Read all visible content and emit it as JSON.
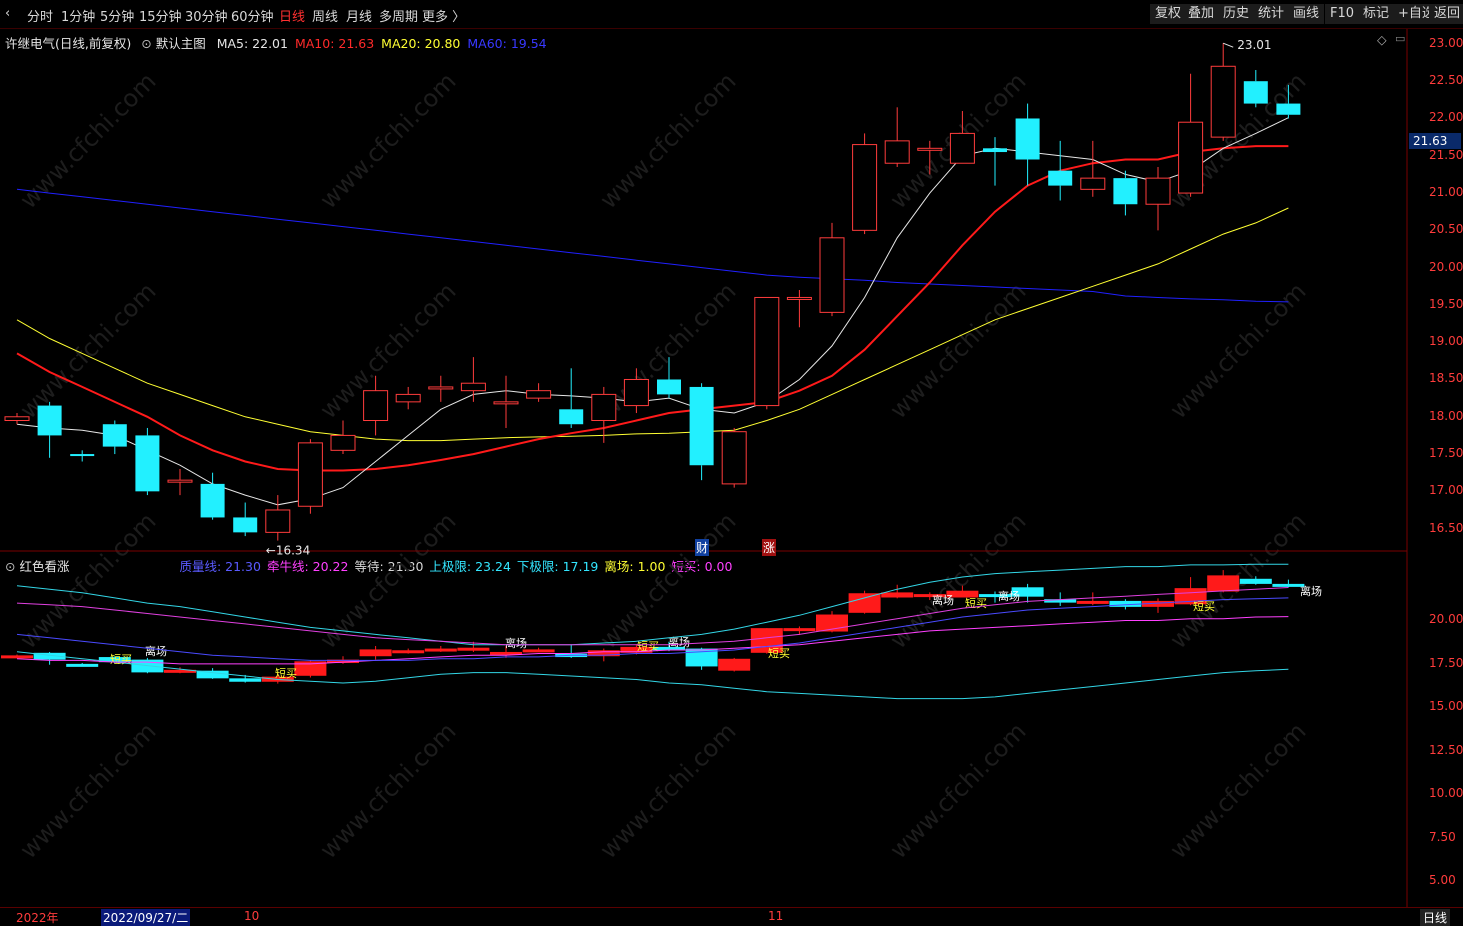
{
  "periods": [
    {
      "label": "分时",
      "active": false
    },
    {
      "label": "1分钟",
      "active": false
    },
    {
      "label": "5分钟",
      "active": false
    },
    {
      "label": "15分钟",
      "active": false
    },
    {
      "label": "30分钟",
      "active": false
    },
    {
      "label": "60分钟",
      "active": false
    },
    {
      "label": "日线",
      "active": true
    },
    {
      "label": "周线",
      "active": false
    },
    {
      "label": "月线",
      "active": false
    },
    {
      "label": "多周期",
      "active": false
    },
    {
      "label": "更多 〉",
      "active": false
    }
  ],
  "toolbar": [
    "复权",
    "叠加",
    "历史",
    "统计",
    "画线",
    "F10",
    "标记",
    "+自选",
    "返回"
  ],
  "legend_main": {
    "stock": "许继电气(日线,前复权)",
    "template": "默认主图",
    "items": [
      {
        "text": "MA5: 22.01",
        "color": "#e6e6e6"
      },
      {
        "text": "MA10: 21.63",
        "color": "#ff2a2a"
      },
      {
        "text": "MA20: 20.80",
        "color": "#ffff33"
      },
      {
        "text": "MA60: 19.54",
        "color": "#3838ff"
      }
    ]
  },
  "legend_sub": {
    "name": "红色看涨",
    "items": [
      {
        "text": "质量线: 21.30",
        "color": "#5a5aff"
      },
      {
        "text": "牵牛线: 20.22",
        "color": "#ff40ff"
      },
      {
        "text": "等待: 21.30",
        "color": "#d8d8d8"
      },
      {
        "text": "上极限: 23.24",
        "color": "#33e6ff"
      },
      {
        "text": "下极限: 17.19",
        "color": "#33e6ff"
      },
      {
        "text": "离场: 1.00",
        "color": "#ffff33"
      },
      {
        "text": "短买: 0.00",
        "color": "#ff40ff"
      }
    ]
  },
  "axis_main": [
    "23.00",
    "22.50",
    "22.00",
    "21.50",
    "21.00",
    "20.50",
    "20.00",
    "19.50",
    "19.00",
    "18.50",
    "18.00",
    "17.50",
    "17.00",
    "16.50"
  ],
  "axis_sub": [
    "20.00",
    "17.50",
    "15.00",
    "12.50",
    "10.00",
    "7.50",
    "5.00"
  ],
  "last_price": "21.63",
  "high_label": "23.01",
  "low_label": "16.34",
  "markers": {
    "cai": "财",
    "zhang": "涨"
  },
  "sub_text": {
    "exit": "离场",
    "buy": "短买"
  },
  "dates": {
    "year": "2022年",
    "cursor": "2022/09/27/二",
    "m10": "10",
    "m11": "11",
    "period": "日线"
  },
  "watermark": "www.cfchi.com",
  "chart_data": {
    "type": "candlestick",
    "ylim": [
      16.2,
      23.2
    ],
    "candles": [
      [
        17.95,
        18.0,
        17.9,
        18.05
      ],
      [
        18.15,
        17.75,
        17.45,
        18.2
      ],
      [
        17.5,
        17.48,
        17.4,
        17.55
      ],
      [
        17.9,
        17.6,
        17.5,
        17.95
      ],
      [
        17.75,
        17.0,
        16.95,
        17.85
      ],
      [
        17.15,
        17.15,
        16.95,
        17.3
      ],
      [
        17.1,
        16.65,
        16.62,
        17.25
      ],
      [
        16.65,
        16.45,
        16.4,
        16.85
      ],
      [
        16.45,
        16.75,
        16.34,
        16.95
      ],
      [
        16.8,
        17.65,
        16.7,
        17.7
      ],
      [
        17.55,
        17.75,
        17.5,
        17.95
      ],
      [
        17.95,
        18.35,
        17.75,
        18.55
      ],
      [
        18.2,
        18.3,
        18.1,
        18.4
      ],
      [
        18.4,
        18.4,
        18.2,
        18.55
      ],
      [
        18.35,
        18.45,
        18.2,
        18.8
      ],
      [
        18.2,
        18.2,
        17.85,
        18.55
      ],
      [
        18.25,
        18.35,
        18.2,
        18.45
      ],
      [
        18.1,
        17.9,
        17.85,
        18.65
      ],
      [
        17.95,
        18.3,
        17.65,
        18.4
      ],
      [
        18.15,
        18.5,
        18.05,
        18.65
      ],
      [
        18.5,
        18.3,
        18.25,
        18.8
      ],
      [
        18.4,
        17.35,
        17.15,
        18.45
      ],
      [
        17.1,
        17.8,
        17.05,
        17.85
      ],
      [
        18.15,
        19.6,
        18.1,
        19.6
      ],
      [
        19.6,
        19.6,
        19.2,
        19.7
      ],
      [
        19.4,
        20.4,
        19.35,
        20.6
      ],
      [
        20.5,
        21.65,
        20.45,
        21.8
      ],
      [
        21.4,
        21.7,
        21.35,
        22.15
      ],
      [
        21.6,
        21.6,
        21.25,
        21.7
      ],
      [
        21.4,
        21.8,
        21.4,
        22.1
      ],
      [
        21.6,
        21.55,
        21.1,
        21.75
      ],
      [
        22.0,
        21.45,
        21.1,
        22.2
      ],
      [
        21.3,
        21.1,
        20.9,
        21.7
      ],
      [
        21.05,
        21.2,
        20.95,
        21.7
      ],
      [
        21.2,
        20.85,
        20.7,
        21.3
      ],
      [
        20.85,
        21.2,
        20.5,
        21.35
      ],
      [
        21.0,
        21.95,
        20.95,
        22.6
      ],
      [
        21.75,
        22.7,
        21.7,
        23.01
      ],
      [
        22.5,
        22.2,
        22.15,
        22.65
      ],
      [
        22.2,
        22.05,
        22.0,
        22.45
      ]
    ],
    "ma5": [
      17.9,
      17.85,
      17.82,
      17.75,
      17.55,
      17.35,
      17.1,
      16.95,
      16.82,
      16.9,
      17.05,
      17.4,
      17.75,
      18.1,
      18.3,
      18.35,
      18.3,
      18.28,
      18.25,
      18.2,
      18.25,
      18.1,
      18.05,
      18.2,
      18.5,
      18.95,
      19.6,
      20.4,
      21.0,
      21.5,
      21.6,
      21.55,
      21.5,
      21.45,
      21.25,
      21.15,
      21.3,
      21.6,
      21.8,
      22.01
    ],
    "ma10": [
      18.85,
      18.6,
      18.4,
      18.2,
      18.0,
      17.75,
      17.55,
      17.4,
      17.3,
      17.28,
      17.28,
      17.3,
      17.35,
      17.42,
      17.5,
      17.6,
      17.7,
      17.78,
      17.85,
      17.95,
      18.05,
      18.1,
      18.15,
      18.2,
      18.35,
      18.55,
      18.9,
      19.35,
      19.8,
      20.3,
      20.75,
      21.1,
      21.3,
      21.4,
      21.45,
      21.45,
      21.55,
      21.6,
      21.63,
      21.63
    ],
    "ma20": [
      19.3,
      19.05,
      18.85,
      18.65,
      18.45,
      18.3,
      18.15,
      18.0,
      17.9,
      17.8,
      17.75,
      17.7,
      17.68,
      17.68,
      17.7,
      17.72,
      17.73,
      17.74,
      17.75,
      17.77,
      17.78,
      17.8,
      17.82,
      17.95,
      18.1,
      18.3,
      18.5,
      18.7,
      18.9,
      19.1,
      19.3,
      19.45,
      19.6,
      19.75,
      19.9,
      20.05,
      20.25,
      20.45,
      20.6,
      20.8
    ],
    "ma60": [
      21.05,
      21.0,
      20.95,
      20.9,
      20.85,
      20.8,
      20.75,
      20.7,
      20.65,
      20.6,
      20.55,
      20.5,
      20.45,
      20.4,
      20.35,
      20.3,
      20.25,
      20.2,
      20.15,
      20.1,
      20.05,
      20.0,
      19.95,
      19.9,
      19.87,
      19.85,
      19.83,
      19.8,
      19.78,
      19.76,
      19.74,
      19.72,
      19.7,
      19.68,
      19.62,
      19.6,
      19.58,
      19.57,
      19.55,
      19.54
    ]
  },
  "chart_data_sub": {
    "type": "line",
    "ylim": [
      3.5,
      24.0
    ],
    "upper": [
      22.0,
      21.8,
      21.6,
      21.3,
      21.0,
      20.8,
      20.5,
      20.2,
      19.9,
      19.6,
      19.4,
      19.2,
      19.0,
      18.8,
      18.6,
      18.6,
      18.6,
      18.6,
      18.7,
      18.8,
      19.0,
      19.2,
      19.5,
      19.9,
      20.3,
      20.8,
      21.3,
      21.8,
      22.2,
      22.5,
      22.7,
      22.8,
      22.9,
      23.0,
      23.1,
      23.1,
      23.2,
      23.2,
      23.24,
      23.24
    ],
    "lower": [
      18.2,
      18.0,
      17.8,
      17.6,
      17.4,
      17.2,
      17.0,
      16.8,
      16.6,
      16.5,
      16.4,
      16.5,
      16.7,
      16.9,
      17.0,
      17.0,
      16.9,
      16.8,
      16.7,
      16.6,
      16.4,
      16.3,
      16.1,
      15.9,
      15.8,
      15.7,
      15.6,
      15.5,
      15.5,
      15.5,
      15.6,
      15.8,
      16.0,
      16.2,
      16.4,
      16.6,
      16.8,
      17.0,
      17.1,
      17.19
    ],
    "purple": [
      21.0,
      20.9,
      20.8,
      20.6,
      20.4,
      20.2,
      20.0,
      19.8,
      19.6,
      19.4,
      19.2,
      19.0,
      18.9,
      18.8,
      18.7,
      18.6,
      18.6,
      18.6,
      18.6,
      18.6,
      18.6,
      18.7,
      18.8,
      19.0,
      19.2,
      19.5,
      19.8,
      20.1,
      20.4,
      20.7,
      20.9,
      21.1,
      21.2,
      21.3,
      21.4,
      21.5,
      21.6,
      21.7,
      21.8,
      21.9
    ],
    "magenta": [
      17.8,
      17.7,
      17.7,
      17.6,
      17.6,
      17.5,
      17.5,
      17.5,
      17.5,
      17.5,
      17.6,
      17.7,
      17.8,
      17.9,
      18.0,
      18.0,
      18.1,
      18.1,
      18.2,
      18.2,
      18.3,
      18.3,
      18.4,
      18.5,
      18.6,
      18.8,
      19.0,
      19.2,
      19.4,
      19.5,
      19.6,
      19.7,
      19.8,
      19.9,
      20.0,
      20.0,
      20.1,
      20.1,
      20.2,
      20.22
    ],
    "blue": [
      19.2,
      19.0,
      18.8,
      18.6,
      18.4,
      18.2,
      18.0,
      17.9,
      17.8,
      17.7,
      17.7,
      17.7,
      17.7,
      17.8,
      17.8,
      17.9,
      17.9,
      18.0,
      18.0,
      18.1,
      18.1,
      18.2,
      18.3,
      18.5,
      18.7,
      19.0,
      19.3,
      19.6,
      19.9,
      20.2,
      20.4,
      20.6,
      20.7,
      20.8,
      20.9,
      21.0,
      21.1,
      21.2,
      21.25,
      21.3
    ]
  }
}
